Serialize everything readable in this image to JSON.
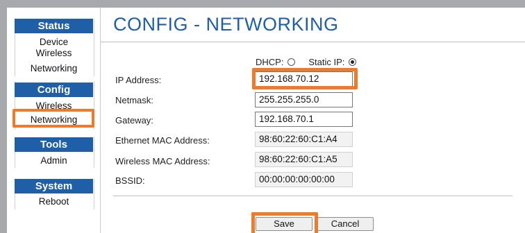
{
  "sidebar": {
    "sections": [
      {
        "title": "Status",
        "items": [
          "Device",
          "Wireless",
          "Networking"
        ]
      },
      {
        "title": "Config",
        "items": [
          "Wireless",
          "Networking"
        ]
      },
      {
        "title": "Tools",
        "items": [
          "Admin"
        ]
      },
      {
        "title": "System",
        "items": [
          "Reboot"
        ]
      }
    ],
    "active_item": "Networking"
  },
  "page": {
    "title": "CONFIG - NETWORKING"
  },
  "mode": {
    "dhcp_label": "DHCP:",
    "static_label": "Static IP:",
    "selected": "Static IP"
  },
  "fields": {
    "ip_address": {
      "label": "IP Address:",
      "value": "192.168.70.12"
    },
    "netmask": {
      "label": "Netmask:",
      "value": "255.255.255.0"
    },
    "gateway": {
      "label": "Gateway:",
      "value": "192.168.70.1"
    },
    "ethernet_mac": {
      "label": "Ethernet MAC Address:",
      "value": "98:60:22:60:C1:A4"
    },
    "wireless_mac": {
      "label": "Wireless MAC Address:",
      "value": "98:60:22:60:C1:A5"
    },
    "bssid": {
      "label": "BSSID:",
      "value": "00:00:00:00:00:00"
    }
  },
  "buttons": {
    "save": "Save",
    "cancel": "Cancel"
  },
  "colors": {
    "accent": "#1f5fa8",
    "highlight": "#ee7a2a",
    "background": "#a7a9ac"
  }
}
